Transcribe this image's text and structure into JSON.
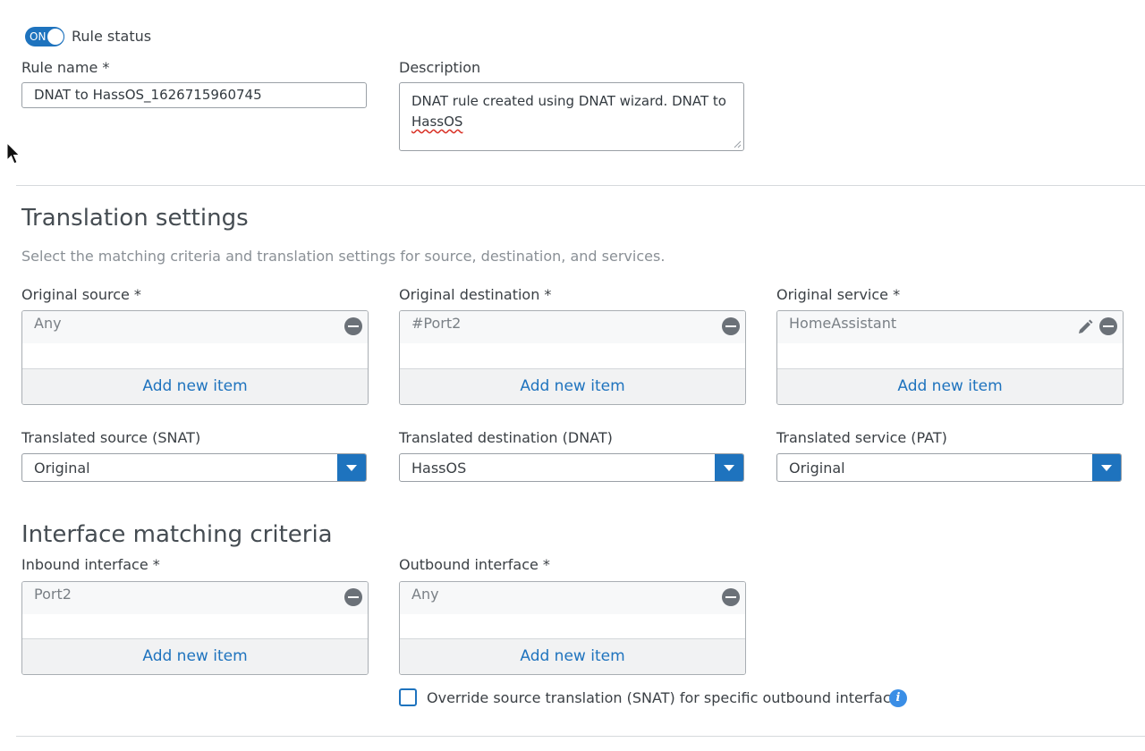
{
  "rule_status": {
    "toggle_label": "ON",
    "label": "Rule status"
  },
  "rule_name": {
    "label": "Rule name *",
    "value": "DNAT to HassOS_1626715960745"
  },
  "description": {
    "label": "Description",
    "value_line1": "DNAT rule created using DNAT wizard. DNAT to",
    "value_line2": "HassOS"
  },
  "translation": {
    "title": "Translation settings",
    "subtitle": "Select the matching criteria and translation settings for source, destination, and services.",
    "original_source": {
      "label": "Original source *",
      "item": "Any",
      "add": "Add new item"
    },
    "original_destination": {
      "label": "Original destination *",
      "item": "#Port2",
      "add": "Add new item"
    },
    "original_service": {
      "label": "Original service *",
      "item": "HomeAssistant",
      "add": "Add new item"
    },
    "translated_source": {
      "label": "Translated source (SNAT)",
      "value": "Original"
    },
    "translated_destination": {
      "label": "Translated destination (DNAT)",
      "value": "HassOS"
    },
    "translated_service": {
      "label": "Translated service (PAT)",
      "value": "Original"
    }
  },
  "interface": {
    "title": "Interface matching criteria",
    "inbound": {
      "label": "Inbound interface *",
      "item": "Port2",
      "add": "Add new item"
    },
    "outbound": {
      "label": "Outbound interface *",
      "item": "Any",
      "add": "Add new item"
    },
    "override_label": "Override source translation (SNAT) for specific outbound interfaces",
    "info_icon": "i"
  },
  "colors": {
    "accent": "#1e73be",
    "info": "#3a8ee6",
    "remove": "#6b7178"
  }
}
